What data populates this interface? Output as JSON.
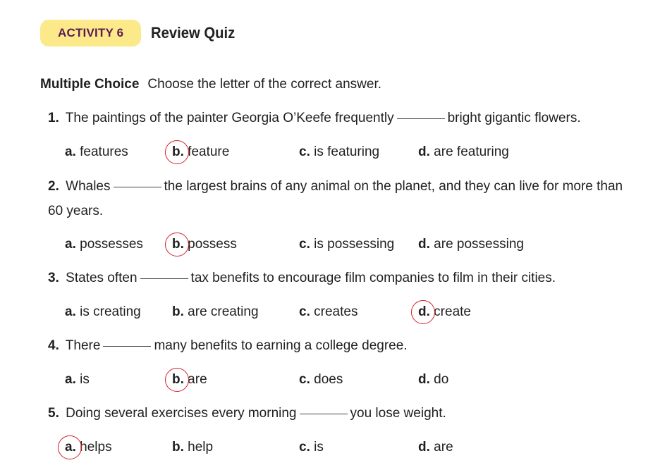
{
  "header": {
    "badge": "ACTIVITY 6",
    "title": "Review Quiz"
  },
  "instructions": {
    "heading": "Multiple Choice",
    "text": "Choose the letter of the correct answer."
  },
  "questions": [
    {
      "number": "1.",
      "before": "The paintings of the painter Georgia O’Keefe frequently",
      "after": "bright gigantic flowers.",
      "options": [
        {
          "letter": "a.",
          "text": "features"
        },
        {
          "letter": "b.",
          "text": "feature"
        },
        {
          "letter": "c.",
          "text": "is featuring"
        },
        {
          "letter": "d.",
          "text": "are featuring"
        }
      ],
      "circled": "b"
    },
    {
      "number": "2.",
      "before": "Whales",
      "after": "the largest brains of any animal on the planet, and they can live for more than 60 years.",
      "options": [
        {
          "letter": "a.",
          "text": "possesses"
        },
        {
          "letter": "b.",
          "text": "possess"
        },
        {
          "letter": "c.",
          "text": "is possessing"
        },
        {
          "letter": "d.",
          "text": "are possessing"
        }
      ],
      "circled": "b"
    },
    {
      "number": "3.",
      "before": "States often",
      "after": "tax benefits to encourage film companies to film in their cities.",
      "options": [
        {
          "letter": "a.",
          "text": "is creating"
        },
        {
          "letter": "b.",
          "text": "are creating"
        },
        {
          "letter": "c.",
          "text": "creates"
        },
        {
          "letter": "d.",
          "text": "create"
        }
      ],
      "circled": "d"
    },
    {
      "number": "4.",
      "before": "There",
      "after": "many benefits to earning a college degree.",
      "options": [
        {
          "letter": "a.",
          "text": "is"
        },
        {
          "letter": "b.",
          "text": "are"
        },
        {
          "letter": "c.",
          "text": "does"
        },
        {
          "letter": "d.",
          "text": "do"
        }
      ],
      "circled": "b"
    },
    {
      "number": "5.",
      "before": "Doing several exercises every morning",
      "after": "you lose weight.",
      "options": [
        {
          "letter": "a.",
          "text": "helps"
        },
        {
          "letter": "b.",
          "text": "help"
        },
        {
          "letter": "c.",
          "text": "is"
        },
        {
          "letter": "d.",
          "text": "are"
        }
      ],
      "circled": "a"
    }
  ],
  "colors": {
    "badge_bg": "#fbe98a",
    "badge_text": "#5a1b4f",
    "circle": "#d21f2a"
  }
}
